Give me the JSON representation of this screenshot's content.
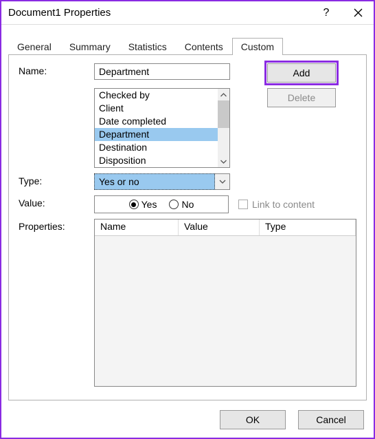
{
  "title": "Document1 Properties",
  "tabs": [
    "General",
    "Summary",
    "Statistics",
    "Contents",
    "Custom"
  ],
  "active_tab": 4,
  "labels": {
    "name": "Name:",
    "type": "Type:",
    "value": "Value:",
    "properties": "Properties:"
  },
  "name_field": {
    "value": "Department",
    "options": [
      "Checked by",
      "Client",
      "Date completed",
      "Department",
      "Destination",
      "Disposition"
    ],
    "selected_index": 3
  },
  "buttons": {
    "add": "Add",
    "delete": "Delete",
    "ok": "OK",
    "cancel": "Cancel"
  },
  "type_field": {
    "value": "Yes or no"
  },
  "value_field": {
    "options": {
      "yes": "Yes",
      "no": "No"
    },
    "selected": "yes"
  },
  "link_to_content": {
    "label": "Link to content",
    "enabled": false,
    "checked": false
  },
  "properties_list": {
    "columns": [
      "Name",
      "Value",
      "Type"
    ],
    "rows": []
  },
  "colors": {
    "accent": "#8a2be2",
    "selection": "#99c9ef"
  }
}
